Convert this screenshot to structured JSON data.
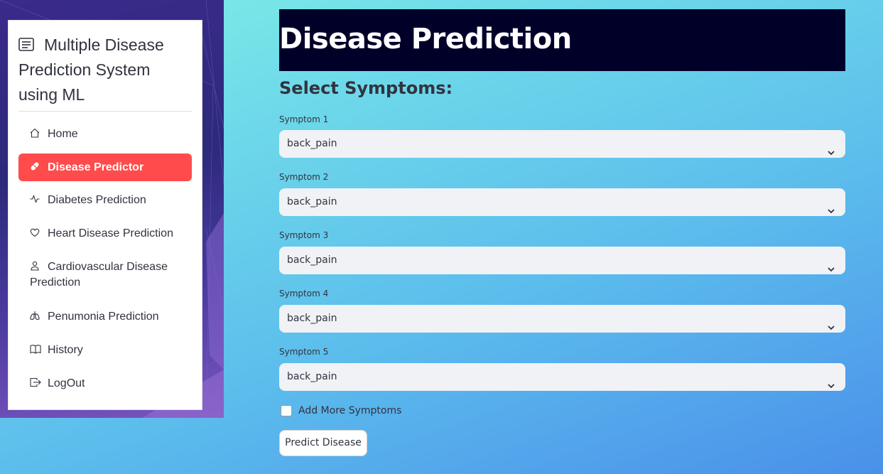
{
  "sidebar": {
    "title_icon": "document-list-icon",
    "title": "Multiple Disease Prediction System using ML",
    "items": [
      {
        "label": "Home",
        "icon": "house-icon",
        "active": false
      },
      {
        "label": "Disease Predictor",
        "icon": "capsule-icon",
        "active": true
      },
      {
        "label": "Diabetes Prediction",
        "icon": "activity-icon",
        "active": false
      },
      {
        "label": "Heart Disease Prediction",
        "icon": "heart-icon",
        "active": false
      },
      {
        "label": "Cardiovascular Disease Prediction",
        "icon": "person-icon",
        "active": false
      },
      {
        "label": "Penumonia Prediction",
        "icon": "lungs-icon",
        "active": false
      },
      {
        "label": "History",
        "icon": "book-icon",
        "active": false
      },
      {
        "label": "LogOut",
        "icon": "box-arrow-right-icon",
        "active": false
      }
    ],
    "active_color": "#ff4b4b"
  },
  "main": {
    "title": "Disease Prediction",
    "subheader": "Select Symptoms:",
    "symptoms": [
      {
        "label": "Symptom 1",
        "value": "back_pain"
      },
      {
        "label": "Symptom 2",
        "value": "back_pain"
      },
      {
        "label": "Symptom 3",
        "value": "back_pain"
      },
      {
        "label": "Symptom 4",
        "value": "back_pain"
      },
      {
        "label": "Symptom 5",
        "value": "back_pain"
      }
    ],
    "add_more_label": "Add More Symptoms",
    "add_more_checked": false,
    "predict_button": "Predict Disease",
    "header_color": "#000029"
  }
}
